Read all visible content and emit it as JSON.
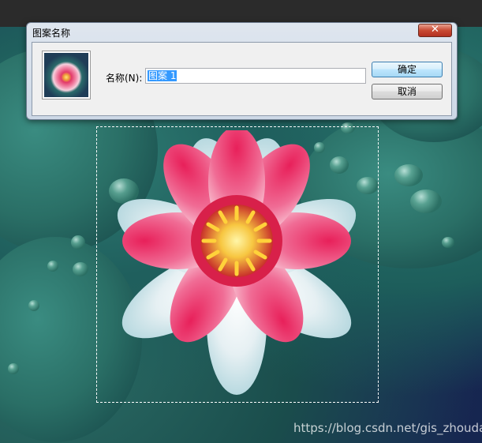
{
  "dialog": {
    "title": "图案名称",
    "close_symbol": "✕",
    "name_label": "名称(N):",
    "name_value": "图案 1",
    "ok_label": "确定",
    "cancel_label": "取消"
  },
  "watermark": "https://blog.csdn.net/gis_zhouda",
  "icons": [
    "close-icon",
    "pattern-thumbnail"
  ]
}
